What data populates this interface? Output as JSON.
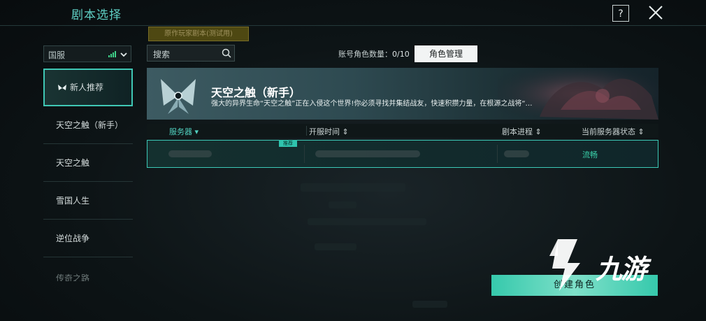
{
  "header": {
    "title": "剧本选择",
    "help_label": "?",
    "scene_tag": "原作玩家剧本(测试用)"
  },
  "region": {
    "label": "国服"
  },
  "search": {
    "placeholder": "搜索"
  },
  "account": {
    "label": "账号角色数量：",
    "count": "0/10",
    "role_button": "角色管理"
  },
  "sidebar": {
    "items": [
      {
        "label": "新人推荐",
        "active": true
      },
      {
        "label": "天空之触（新手）"
      },
      {
        "label": "天空之触"
      },
      {
        "label": "雪国人生"
      },
      {
        "label": "逆位战争"
      },
      {
        "label": "传奇之路"
      }
    ]
  },
  "banner": {
    "title": "天空之触（新手）",
    "description": "强大的异界生命“天空之触”正在入侵这个世界!你必须寻找并集结战友，快速积攒力量，在根源之战将“…"
  },
  "table": {
    "columns": [
      "服务器",
      "开服时间",
      "剧本进程",
      "当前服务器状态"
    ],
    "rows": [
      {
        "badge": "推荐",
        "status": "流畅"
      }
    ]
  },
  "create_button": "创建角色",
  "watermark": {
    "text": "九游"
  },
  "colors": {
    "accent": "#3fc7b4",
    "status_ok": "#3ad1ab"
  }
}
